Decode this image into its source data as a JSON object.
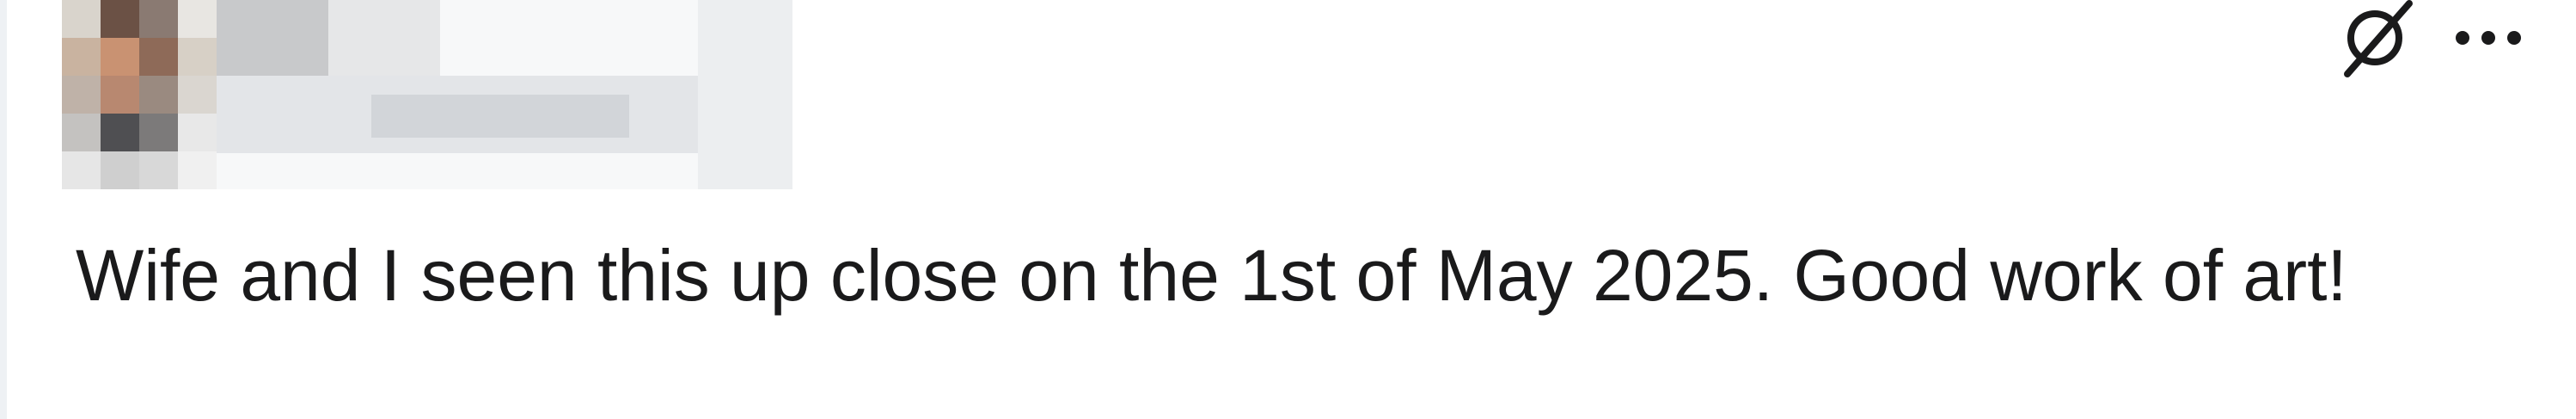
{
  "post": {
    "body_text": "Wife and I seen this up close on the 1st of May 2025. Good work of art!",
    "author_redacted": true
  },
  "actions": {
    "award_icon": "slashed-circle-icon",
    "more_icon": "ellipsis-icon"
  },
  "colors": {
    "text": "#1a1a1b",
    "icon": "#1a1a1b",
    "border": "#eef1f4"
  }
}
